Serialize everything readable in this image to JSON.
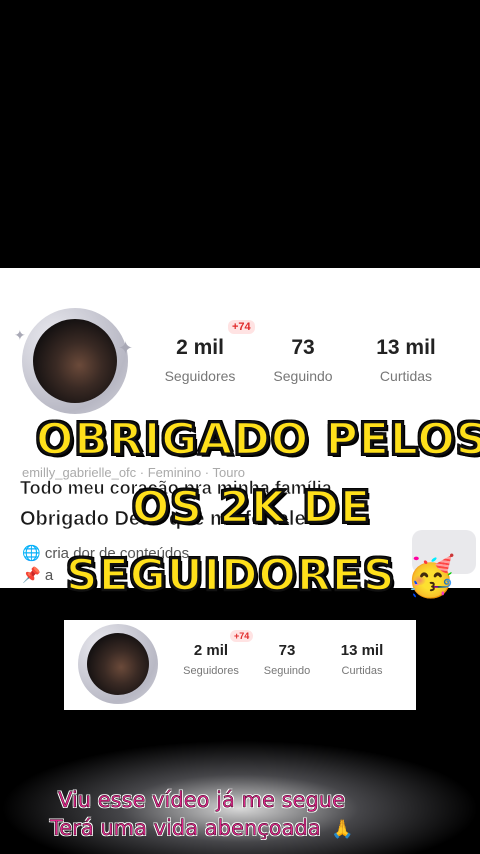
{
  "profile": {
    "stats": [
      {
        "value": "2 mil",
        "label": "Seguidores",
        "badge": "+74"
      },
      {
        "value": "73",
        "label": "Seguindo"
      },
      {
        "value": "13 mil",
        "label": "Curtidas"
      }
    ],
    "meta_line": "emilly_gabrielle_ofc · Feminino · Touro",
    "bio_line1": "Todo meu coração pra minha família",
    "bio_line2": "Obrigado Deus que me fortalece",
    "bio_line3": "cria dor de conteúdos",
    "bio_line4": "a"
  },
  "overlay": {
    "line1": "OBRIGADO  PELOS",
    "line2": "OS 2K DE",
    "line3": "SEGUIDORES",
    "emoji": "🥳"
  },
  "mini_card": {
    "stats": [
      {
        "value": "2 mil",
        "label": "Seguidores",
        "badge": "+74"
      },
      {
        "value": "73",
        "label": "Seguindo"
      },
      {
        "value": "13 mil",
        "label": "Curtidas"
      }
    ]
  },
  "captions": {
    "line1": "Viu esse vídeo já me segue",
    "line2": "Terá uma vida abençoada",
    "emoji": "🙏"
  }
}
